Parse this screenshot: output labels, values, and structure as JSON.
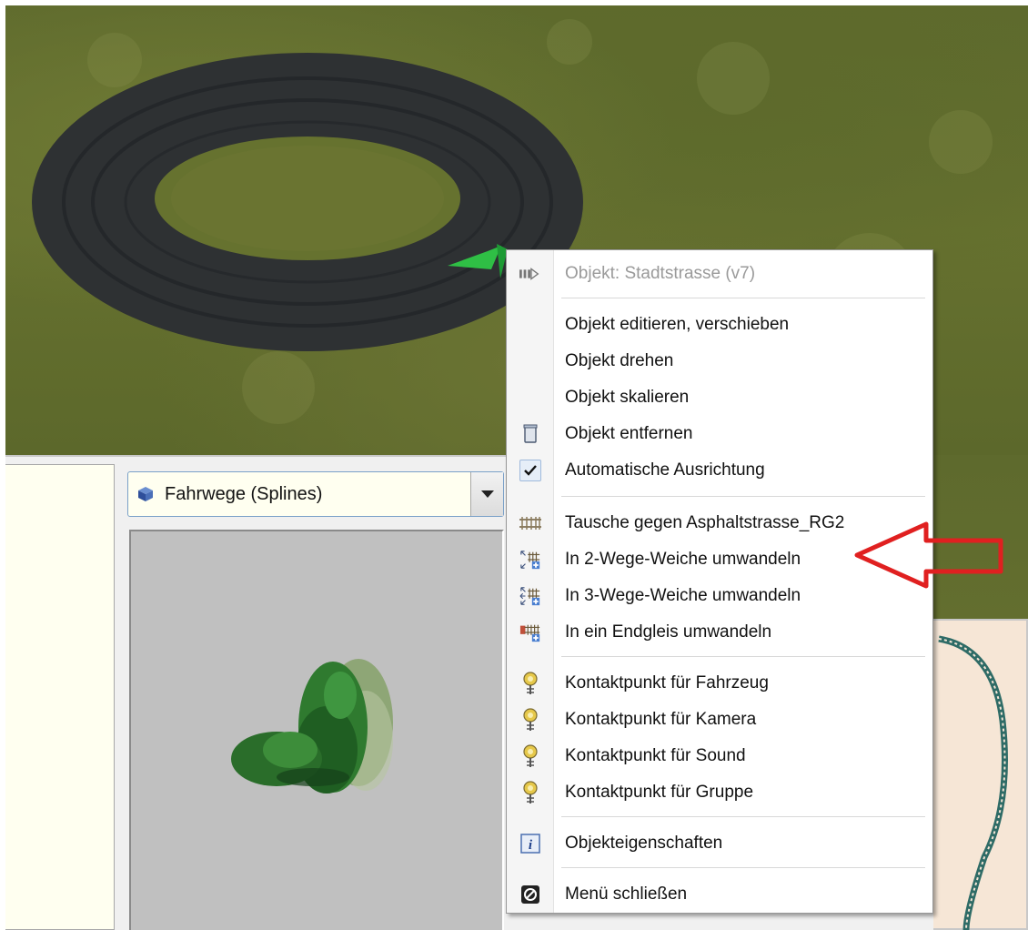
{
  "viewport": {
    "name": "3D scene"
  },
  "dropdown": {
    "label": "Fahrwege (Splines)",
    "icon": "cube-icon"
  },
  "context_menu": {
    "header": "Objekt: Stadtstrasse (v7)",
    "items": [
      {
        "label": "Objekt editieren, verschieben",
        "icon": ""
      },
      {
        "label": "Objekt drehen",
        "icon": ""
      },
      {
        "label": "Objekt skalieren",
        "icon": ""
      },
      {
        "label": "Objekt entfernen",
        "icon": "trash-icon"
      },
      {
        "label": "Automatische Ausrichtung",
        "icon": "checkmark-icon",
        "checked": true
      },
      {
        "label": "Tausche gegen Asphaltstrasse_RG2",
        "icon": "track-swap-icon"
      },
      {
        "label": "In 2-Wege-Weiche umwandeln",
        "icon": "switch-2way-icon"
      },
      {
        "label": "In 3-Wege-Weiche umwandeln",
        "icon": "switch-3way-icon"
      },
      {
        "label": "In ein Endgleis umwandeln",
        "icon": "end-track-icon"
      },
      {
        "label": "Kontaktpunkt für Fahrzeug",
        "icon": "contact-point-icon"
      },
      {
        "label": "Kontaktpunkt für Kamera",
        "icon": "contact-point-icon"
      },
      {
        "label": "Kontaktpunkt für Sound",
        "icon": "contact-point-icon"
      },
      {
        "label": "Kontaktpunkt für Gruppe",
        "icon": "contact-point-icon"
      },
      {
        "label": "Objekteigenschaften",
        "icon": "info-icon"
      },
      {
        "label": "Menü schließen",
        "icon": "close-menu-icon"
      }
    ]
  },
  "colors": {
    "highlight_arrow": "#e02020",
    "road": "#2e3133",
    "grass": "#627030"
  }
}
